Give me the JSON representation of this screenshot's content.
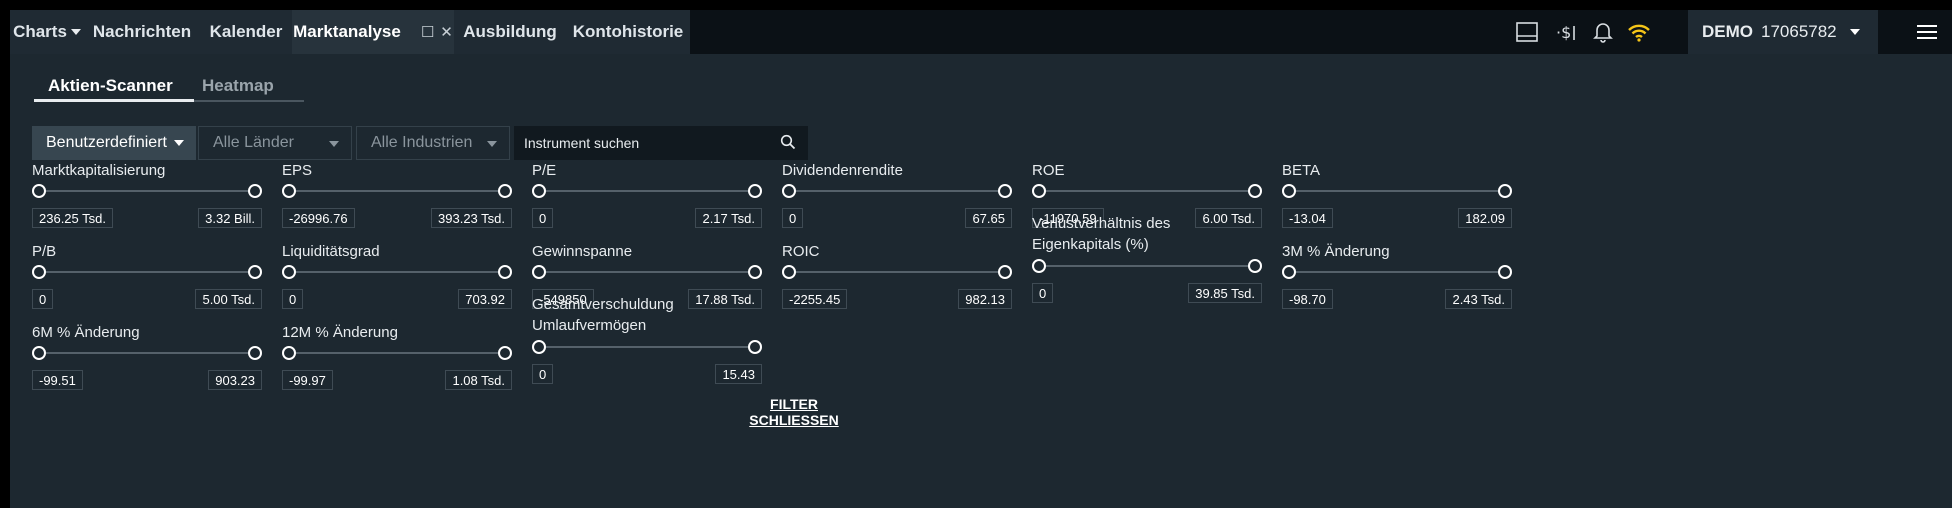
{
  "topbar": {
    "tabs": [
      {
        "label": "Charts"
      },
      {
        "label": "Nachrichten"
      },
      {
        "label": "Kalender"
      },
      {
        "label": "Marktanalyse"
      },
      {
        "label": "Ausbildung"
      },
      {
        "label": "Kontohistorie"
      }
    ],
    "icons": [
      "layout-icon",
      "currency-icon",
      "bell-icon",
      "wifi-icon",
      "hamburger-menu-icon"
    ],
    "account": {
      "type": "DEMO",
      "number": "17065782"
    }
  },
  "subtabs": [
    {
      "label": "Aktien-Scanner",
      "active": true
    },
    {
      "label": "Heatmap",
      "active": false
    }
  ],
  "filters_bar": {
    "preset": "Benutzerdefiniert",
    "countries": "Alle Länder",
    "industries": "Alle Industrien",
    "search_placeholder": "Instrument suchen"
  },
  "filters": [
    {
      "label": "Marktkapitalisierung",
      "min": "236.25 Tsd.",
      "max": "3.32 Bill."
    },
    {
      "label": "EPS",
      "min": "-26996.76",
      "max": "393.23 Tsd."
    },
    {
      "label": "P/E",
      "min": "0",
      "max": "2.17 Tsd."
    },
    {
      "label": "Dividendenrendite",
      "min": "0",
      "max": "67.65"
    },
    {
      "label": "ROE",
      "min": "-11970.59",
      "max": "6.00 Tsd."
    },
    {
      "label": "BETA",
      "min": "-13.04",
      "max": "182.09"
    },
    {
      "label": "P/B",
      "min": "0",
      "max": "5.00 Tsd."
    },
    {
      "label": "Liquiditätsgrad",
      "min": "0",
      "max": "703.92"
    },
    {
      "label": "Gewinnspanne",
      "min": "-549850",
      "max": "17.88 Tsd."
    },
    {
      "label": "ROIC",
      "min": "-2255.45",
      "max": "982.13"
    },
    {
      "label": "Verlustverhältnis des Eigenkapitals (%)",
      "min": "0",
      "max": "39.85 Tsd."
    },
    {
      "label": "3M % Änderung",
      "min": "-98.70",
      "max": "2.43 Tsd."
    },
    {
      "label": "6M % Änderung",
      "min": "-99.51",
      "max": "903.23"
    },
    {
      "label": "12M % Änderung",
      "min": "-99.97",
      "max": "1.08 Tsd."
    },
    {
      "label": "Gesamtverschuldung Umlaufvermögen",
      "min": "0",
      "max": "15.43"
    }
  ],
  "close_filter_label": "FILTER SCHLIESSEN",
  "colors": {
    "background": "#1d2830",
    "topbar": "#0b1116",
    "tab": "#1f2a33",
    "active_tab": "#27333c",
    "wifi": "#f5c518"
  }
}
